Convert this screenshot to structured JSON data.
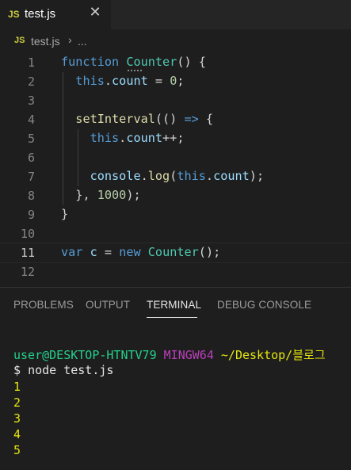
{
  "tab": {
    "icon": "JS",
    "filename": "test.js",
    "close": "✕"
  },
  "breadcrumb": {
    "icon": "JS",
    "file": "test.js",
    "separator": "›",
    "more": "..."
  },
  "editor": {
    "lines": [
      {
        "num": "1"
      },
      {
        "num": "2"
      },
      {
        "num": "3"
      },
      {
        "num": "4"
      },
      {
        "num": "5"
      },
      {
        "num": "6"
      },
      {
        "num": "7"
      },
      {
        "num": "8"
      },
      {
        "num": "9"
      },
      {
        "num": "10"
      },
      {
        "num": "11"
      },
      {
        "num": "12"
      }
    ],
    "tokens": {
      "function": "function",
      "counter": "Counter",
      "parens_brace": "() {",
      "this": "this",
      "count": "count",
      "assign_zero_a": " = ",
      "zero": "0",
      "semi": ";",
      "setInterval": "setInterval",
      "paren_arrow_open": "(() ",
      "arrow": "=>",
      "brace_open": " {",
      "dot": ".",
      "inc": "++;",
      "console": "console",
      "log": "log",
      "paren_open": "(",
      "paren_close_semi": ");",
      "close_interval_a": "}, ",
      "thousand": "1000",
      "close_interval_b": ");",
      "brace_close": "}",
      "var": "var",
      "c": "c",
      "eq": " = ",
      "new": "new",
      "call_end": "();"
    }
  },
  "panel": {
    "tabs": [
      "PROBLEMS",
      "OUTPUT",
      "TERMINAL",
      "DEBUG CONSOLE"
    ],
    "active_tab": "TERMINAL",
    "terminal": {
      "user_host": "user@DESKTOP-HTNTV79",
      "shell": "MINGW64",
      "path": "~/Desktop/블로그",
      "prompt": "$",
      "command": "node test.js",
      "output": [
        "1",
        "2",
        "3",
        "4",
        "5"
      ]
    }
  },
  "colors": {
    "background": "#1e1e1e",
    "keyword": "#569cd6",
    "class": "#4ec9b0",
    "function": "#dcdcaa",
    "property": "#9cdcfe",
    "number": "#b5cea8",
    "terminal_green": "#23d18b",
    "terminal_magenta": "#bc3fbc",
    "terminal_yellow": "#e5e510"
  }
}
